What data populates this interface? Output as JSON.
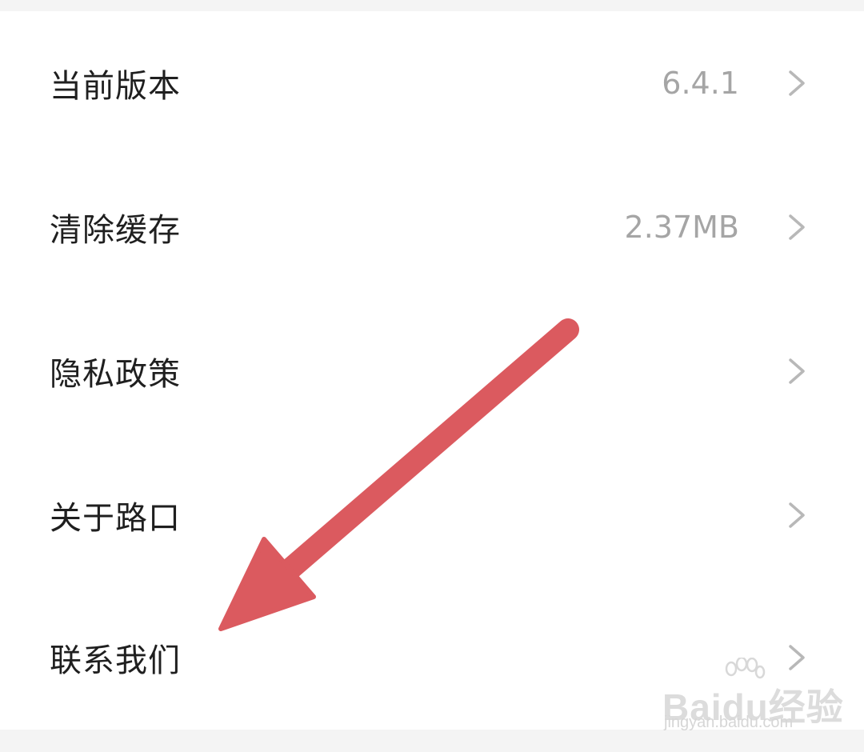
{
  "settings": {
    "items": [
      {
        "label": "当前版本",
        "value": "6.4.1",
        "icon": "chevron-right-icon"
      },
      {
        "label": "清除缓存",
        "value": "2.37MB",
        "icon": "chevron-right-icon"
      },
      {
        "label": "隐私政策",
        "value": "",
        "icon": "chevron-right-icon"
      },
      {
        "label": "关于路口",
        "value": "",
        "icon": "chevron-right-icon"
      },
      {
        "label": "联系我们",
        "value": "",
        "icon": "chevron-right-icon"
      }
    ]
  },
  "annotation": {
    "icon": "red-arrow-icon",
    "color": "#db5a5f"
  },
  "watermark": {
    "logo_text": "Baidu经验",
    "url": "jingyan.baidu.com"
  },
  "colors": {
    "background": "#f4f4f4",
    "panel": "#ffffff",
    "label": "#1f1f1f",
    "value": "#a5a5a5",
    "chevron": "#b8b8b8"
  }
}
